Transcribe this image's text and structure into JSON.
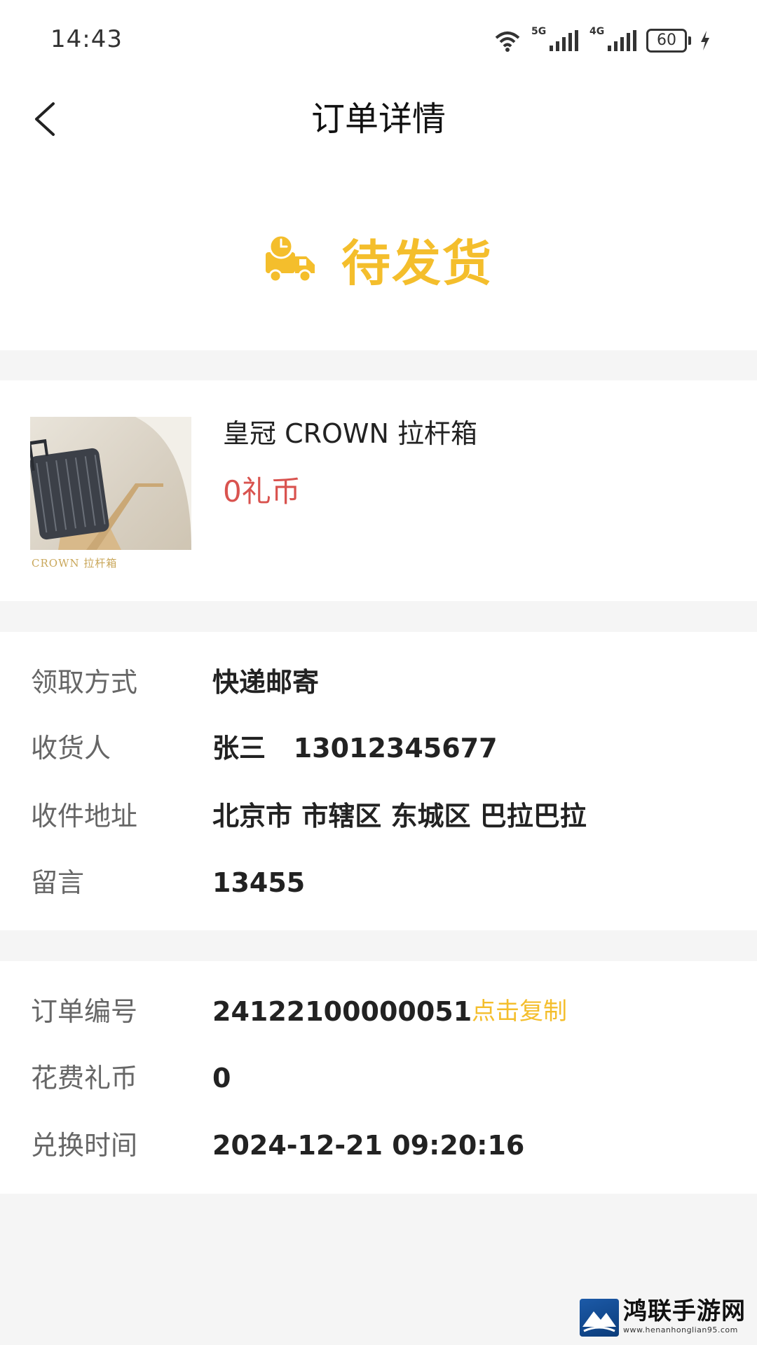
{
  "status_bar": {
    "time": "14:43",
    "network_1": "5G",
    "network_2": "4G",
    "battery": "60"
  },
  "header": {
    "title": "订单详情"
  },
  "order_status": {
    "text": "待发货",
    "icon": "delivery-truck-clock-icon",
    "color": "#f4be2c"
  },
  "product": {
    "name": "皇冠 CROWN 拉杆箱",
    "price": "0礼币",
    "image_caption": "CROWN 拉杆箱",
    "price_color": "#d9534f"
  },
  "shipping": {
    "rows": [
      {
        "label": "领取方式",
        "value": "快递邮寄"
      },
      {
        "label": "收货人",
        "value": "张三   13012345677"
      },
      {
        "label": "收件地址",
        "value": "北京市 市辖区 东城区 巴拉巴拉"
      },
      {
        "label": "留言",
        "value": "13455"
      }
    ]
  },
  "order_info": {
    "rows": [
      {
        "label": "订单编号",
        "value": "24122100000051"
      },
      {
        "label": "花费礼币",
        "value": "0"
      },
      {
        "label": "兑换时间",
        "value": "2024-12-21 09:20:16"
      }
    ],
    "copy_label": "点击复制"
  },
  "watermark": {
    "text": "鸿联手游网",
    "url": "www.henanhonglian95.com"
  }
}
